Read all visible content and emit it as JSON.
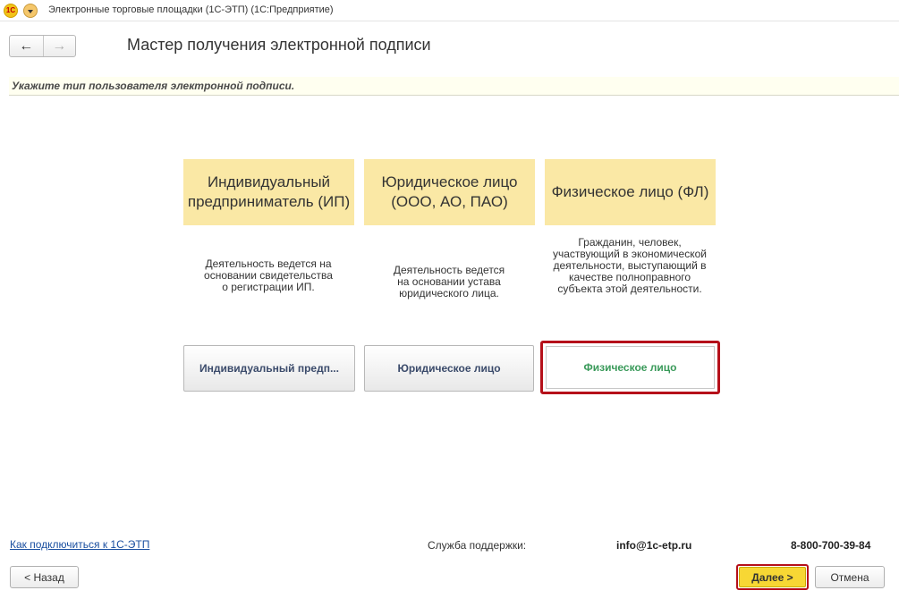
{
  "window": {
    "logo_text": "1С",
    "title": "Электронные торговые площадки (1С-ЭТП)   (1С:Предприятие)"
  },
  "nav": {
    "back_icon": "←",
    "forward_icon": "→"
  },
  "page": {
    "title": "Мастер получения электронной подписи",
    "instruction": "Укажите тип пользователя электронной подписи."
  },
  "cards": [
    {
      "header": "Индивидуальный предприниматель (ИП)",
      "description": "Деятельность ведется на основании свидетельства о регистрации ИП.",
      "button": "Индивидуальный предп..."
    },
    {
      "header": "Юридическое лицо (ООО, АО, ПАО)",
      "description": "Деятельность ведется на основании устава юридического лица.",
      "button": "Юридическое лицо"
    },
    {
      "header": "Физическое лицо (ФЛ)",
      "description": "Гражданин, человек, участвующий в экономической деятельности, выступающий в качестве полноправного субъекта этой деятельности.",
      "button": "Физическое лицо",
      "selected": true
    }
  ],
  "footer": {
    "help_link": "Как подключиться к 1С-ЭТП",
    "support_label": "Служба поддержки:",
    "support_email": "info@1c-etp.ru",
    "support_phone": "8-800-700-39-84",
    "back": "< Назад",
    "next": "Далее >",
    "cancel": "Отмена"
  },
  "colors": {
    "card_header_bg": "#fae8a5",
    "selection_border": "#b5101a",
    "selected_text": "#3a9a5a",
    "next_button_bg": "#f7d734",
    "link": "#1a4fa0"
  }
}
